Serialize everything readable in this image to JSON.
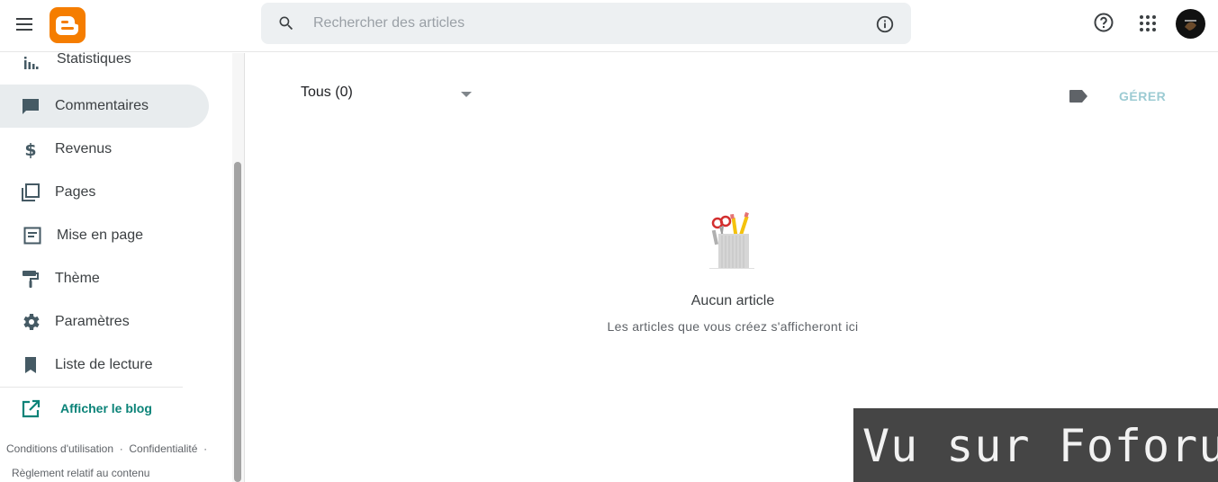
{
  "header": {
    "search_placeholder": "Rechercher des articles"
  },
  "sidebar": {
    "items": [
      {
        "label": "Statistiques"
      },
      {
        "label": "Commentaires"
      },
      {
        "label": "Revenus"
      },
      {
        "label": "Pages"
      },
      {
        "label": "Mise en page"
      },
      {
        "label": "Thème"
      },
      {
        "label": "Paramètres"
      },
      {
        "label": "Liste de lecture"
      }
    ],
    "active_item": "Commentaires",
    "view_blog": "Afficher le blog",
    "footer": {
      "terms": "Conditions d'utilisation",
      "privacy": "Confidentialité",
      "content_policy": "Règlement relatif au contenu",
      "separator": "·"
    }
  },
  "main": {
    "filter_label": "Tous (0)",
    "manage_label": "GÉRER",
    "empty_title": "Aucun article",
    "empty_subtitle": "Les articles que vous créez s'afficheront ici"
  },
  "watermark": {
    "text": "Vu sur Foforum"
  },
  "colors": {
    "brand_orange": "#f57d00",
    "accent_teal": "#0b8378",
    "active_bg": "#e8ecee",
    "manage_disabled": "#9ccbd3"
  }
}
